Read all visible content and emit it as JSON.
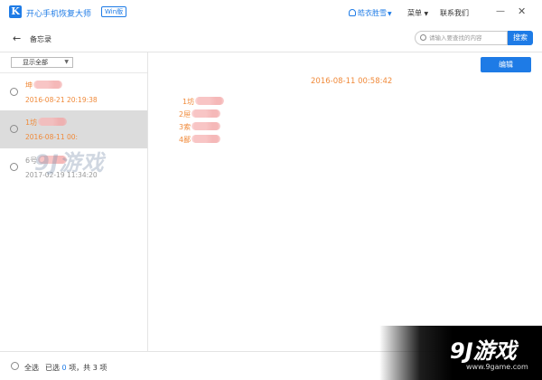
{
  "app": {
    "logo_letter": "K",
    "title": "开心手机恢复大师",
    "edition_badge": "Win版",
    "user_name": "皓衣胜雪",
    "menu_label": "菜单",
    "contact_label": "联系我们",
    "minimize_glyph": "—",
    "close_glyph": "✕",
    "brand_color": "#1e7be6"
  },
  "toolbar": {
    "back_glyph": "←",
    "breadcrumb": "备忘录",
    "search_placeholder": "请输入要查找的内容",
    "search_button": "搜索"
  },
  "sidebar": {
    "filter_value": "显示全部",
    "notes": [
      {
        "title": "坤",
        "date": "2016-08-21 20:19:38",
        "selected": false
      },
      {
        "title": "1坊",
        "date": "2016-08-11 00:",
        "selected": true
      },
      {
        "title": "6号",
        "date": "2017-02-19 11:34:20",
        "selected": false
      }
    ]
  },
  "main": {
    "edit_button": "编辑",
    "note_date": "2016-08-11 00:58:42",
    "lines": [
      "1坊",
      "2屉",
      "3索",
      "4鄙"
    ]
  },
  "footer": {
    "select_all": "全选",
    "selected_prefix": "已选",
    "selected_count": "0",
    "selected_suffix": "项，共 3 项"
  },
  "watermark": {
    "mid_text": "9J游戏",
    "corner_text": "9J游戏",
    "corner_url": "www.9game.com"
  }
}
